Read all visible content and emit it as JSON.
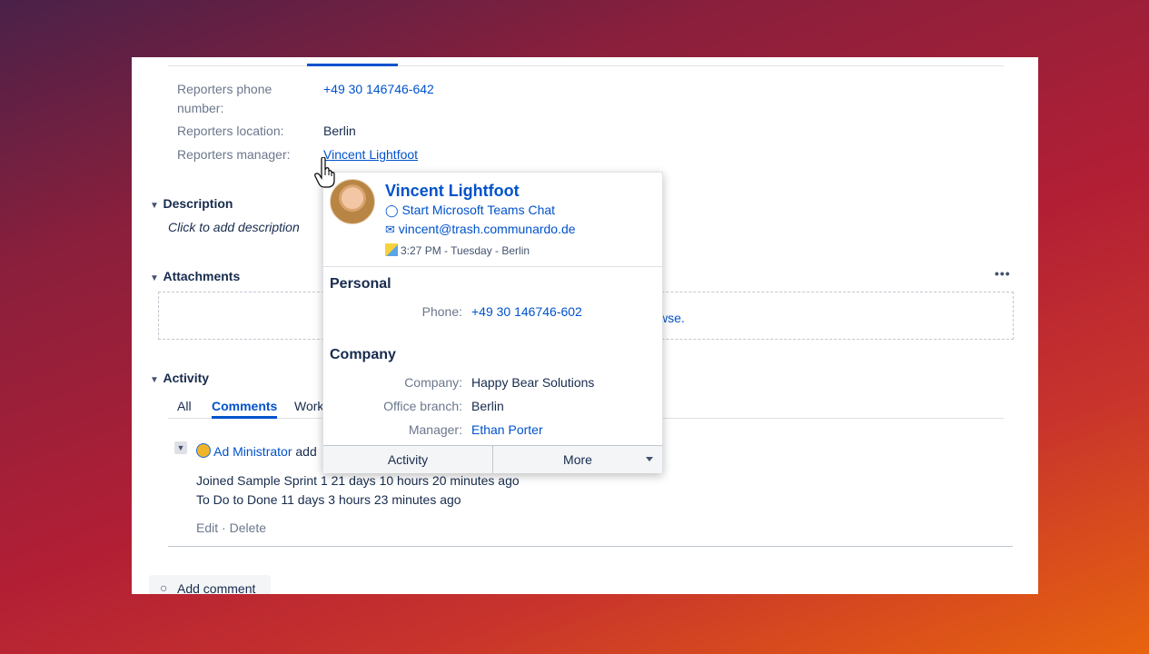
{
  "fields": {
    "phone_label": "Reporters phone",
    "phone_label2": "number:",
    "phone_value": "+49 30 146746-642",
    "location_label": "Reporters location:",
    "location_value": "Berlin",
    "manager_label": "Reporters manager:",
    "manager_value": "Vincent Lightfoot"
  },
  "description": {
    "title": "Description",
    "placeholder": "Click to add description"
  },
  "attachments": {
    "title": "Attachments",
    "more_icon": "more-horizontal-icon",
    "dropzone_text": "wse."
  },
  "activity": {
    "title": "Activity",
    "tabs": [
      "All",
      "Comments",
      "Work"
    ],
    "entry": {
      "author": "Ad Ministrator",
      "action": "add",
      "line1": "Joined Sample Sprint 1 21 days 10 hours 20 minutes ago",
      "line2": "To Do to Done 11 days 3 hours 23 minutes ago",
      "edit": "Edit",
      "sep": "·",
      "delete": "Delete"
    },
    "add_comment": "Add comment"
  },
  "card": {
    "name": "Vincent Lightfoot",
    "teams": "Start Microsoft Teams Chat",
    "email": "vincent@trash.communardo.de",
    "time": "3:27 PM - Tuesday - Berlin",
    "personal_title": "Personal",
    "phone_label": "Phone:",
    "phone_value": "+49 30 146746-602",
    "company_title": "Company",
    "company_label": "Company:",
    "company_value": "Happy Bear Solutions",
    "branch_label": "Office branch:",
    "branch_value": "Berlin",
    "manager_label": "Manager:",
    "manager_value": "Ethan Porter",
    "activity_btn": "Activity",
    "more_btn": "More"
  },
  "colors": {
    "link": "#0052cc",
    "text": "#172b4d",
    "muted": "#6b778c"
  }
}
